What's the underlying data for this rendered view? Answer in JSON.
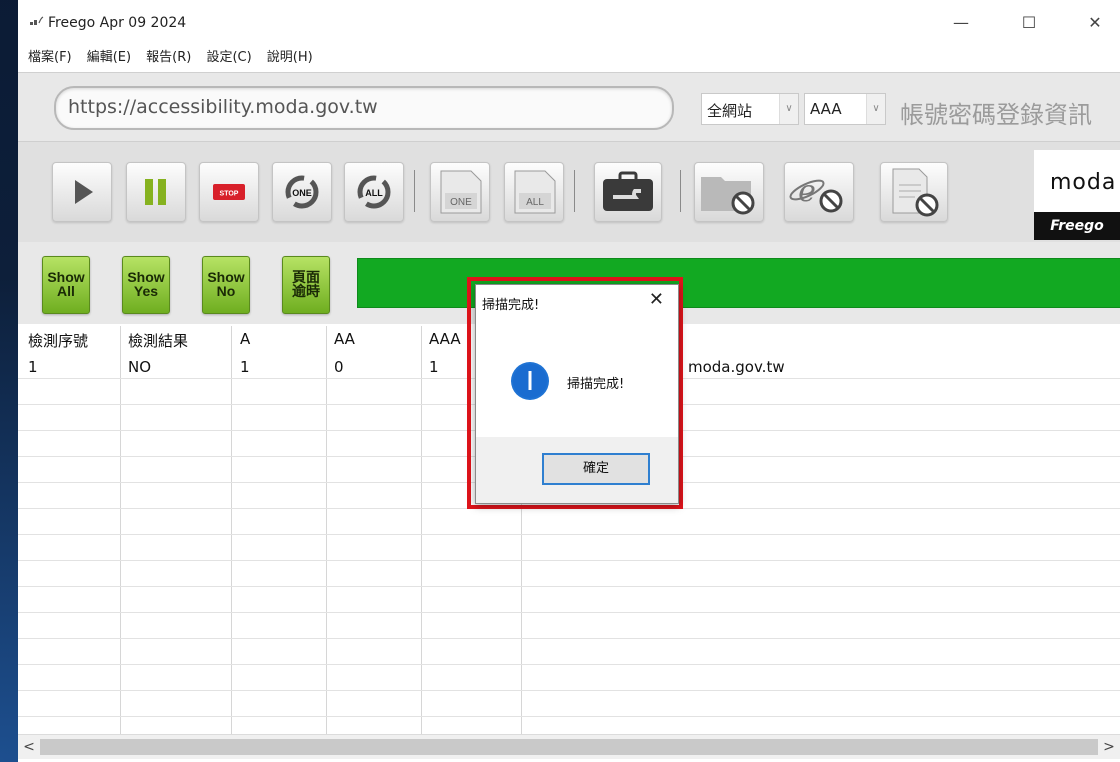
{
  "window": {
    "title": "Freego Apr 09 2024",
    "controls": {
      "minimize": "—",
      "maximize": "☐",
      "close": "✕"
    }
  },
  "menu": [
    "檔案(F)",
    "編輯(E)",
    "報告(R)",
    "設定(C)",
    "說明(H)"
  ],
  "address": {
    "url": "https://accessibility.moda.gov.tw",
    "scope_select": "全網站",
    "level_select": "AAA",
    "login_label": "帳號密碼登錄資訊"
  },
  "toolbar": {
    "buttons": [
      {
        "name": "play",
        "label": ""
      },
      {
        "name": "pause",
        "label": ""
      },
      {
        "name": "stop",
        "label": "STOP"
      },
      {
        "name": "refresh-one",
        "label": "ONE"
      },
      {
        "name": "refresh-all",
        "label": "ALL"
      },
      {
        "name": "file-one",
        "label": "ONE"
      },
      {
        "name": "file-all",
        "label": "ALL"
      },
      {
        "name": "toolbox",
        "label": ""
      },
      {
        "name": "no-folder",
        "label": ""
      },
      {
        "name": "no-ie",
        "label": ""
      },
      {
        "name": "no-doc",
        "label": ""
      }
    ],
    "logo_text": "moda",
    "logo_brand": "Freego"
  },
  "show_buttons": [
    {
      "label": "Show\nAll"
    },
    {
      "label": "Show\nYes"
    },
    {
      "label": "Show\nNo"
    },
    {
      "label": "頁面\n逾時"
    }
  ],
  "progress": {
    "value": 1.0,
    "color": "#12a922"
  },
  "table": {
    "columns": [
      "檢測序號",
      "檢測結果",
      "A",
      "AA",
      "AAA",
      ""
    ],
    "rows": [
      [
        "1",
        "NO",
        "1",
        "0",
        "1",
        "https://accessibility.moda.gov.tw"
      ]
    ],
    "visible_url_fragment": "moda.gov.tw"
  },
  "dialog": {
    "title": "掃描完成!",
    "message": "掃描完成!",
    "ok_label": "確定",
    "close_glyph": "✕",
    "highlight_color": "#e0141b"
  },
  "scrollbar": {
    "left": "<",
    "right": ">"
  }
}
